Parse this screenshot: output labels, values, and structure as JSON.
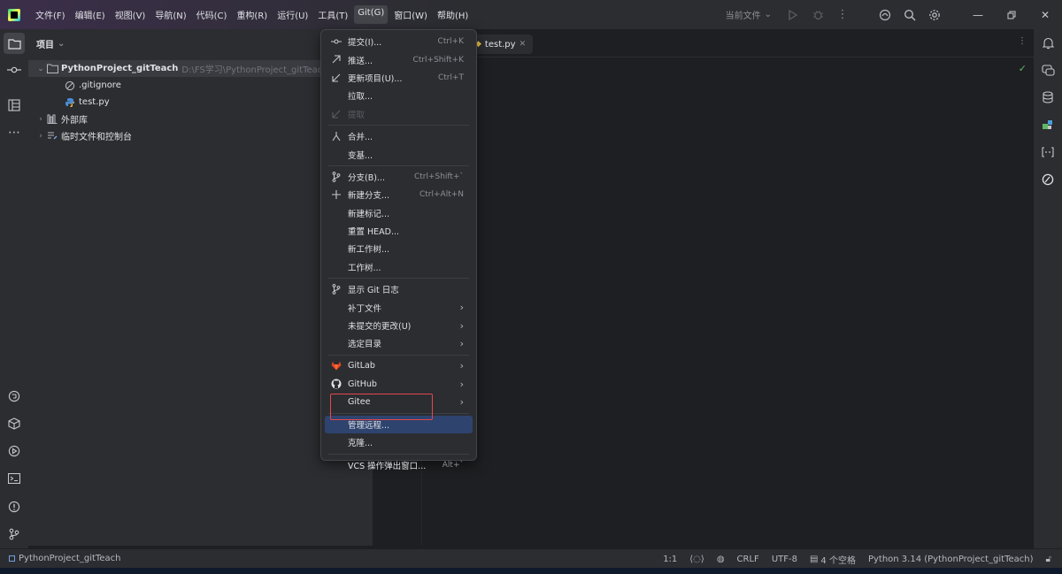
{
  "menubar": {
    "items": [
      "文件(F)",
      "编辑(E)",
      "视图(V)",
      "导航(N)",
      "代码(C)",
      "重构(R)",
      "运行(U)",
      "工具(T)",
      "Git(G)",
      "窗口(W)",
      "帮助(H)"
    ],
    "active_index": 8,
    "run_config": "当前文件"
  },
  "project_panel": {
    "title": "项目",
    "tree": [
      {
        "label": "PythonProject_gitTeach",
        "hint": "D:\\FS学习\\PythonProject_gitTeach",
        "icon": "folder-icon",
        "expanded": true,
        "level": 0,
        "bold": true
      },
      {
        "label": ".gitignore",
        "icon": "ignore-file-icon",
        "level": 1
      },
      {
        "label": "test.py",
        "icon": "python-file-icon",
        "level": 1
      },
      {
        "label": "外部库",
        "icon": "library-icon",
        "level": 0,
        "collapsed": true
      },
      {
        "label": "临时文件和控制台",
        "icon": "scratch-icon",
        "level": 0,
        "collapsed": true
      }
    ]
  },
  "editor": {
    "tab_label": "test.py"
  },
  "git_menu": {
    "items": [
      {
        "label": "提交(I)...",
        "shortcut": "Ctrl+K",
        "icon": "commit-icon"
      },
      {
        "label": "推送...",
        "shortcut": "Ctrl+Shift+K",
        "icon": "push-arrow-icon"
      },
      {
        "label": "更新项目(U)...",
        "shortcut": "Ctrl+T",
        "icon": "update-arrow-icon"
      },
      {
        "label": "拉取...",
        "shortcut": ""
      },
      {
        "label": "提取",
        "shortcut": "",
        "icon": "fetch-arrow-icon",
        "disabled": true
      },
      {
        "label": "合并...",
        "shortcut": "",
        "icon": "merge-icon"
      },
      {
        "label": "变基...",
        "shortcut": ""
      },
      {
        "label": "分支(B)...",
        "shortcut": "Ctrl+Shift+`",
        "icon": "branch-icon"
      },
      {
        "label": "新建分支...",
        "shortcut": "Ctrl+Alt+N",
        "icon": "plus-icon"
      },
      {
        "label": "新建标记...",
        "shortcut": ""
      },
      {
        "label": "重置 HEAD...",
        "shortcut": ""
      },
      {
        "label": "新工作树...",
        "shortcut": ""
      },
      {
        "label": "工作树...",
        "shortcut": ""
      },
      {
        "label": "显示 Git 日志",
        "shortcut": "",
        "icon": "git-log-icon"
      },
      {
        "label": "补丁文件",
        "submenu": true
      },
      {
        "label": "未提交的更改(U)",
        "submenu": true
      },
      {
        "label": "选定目录",
        "submenu": true
      },
      {
        "label": "GitLab",
        "submenu": true,
        "icon": "gitlab-icon"
      },
      {
        "label": "GitHub",
        "submenu": true,
        "icon": "github-icon"
      },
      {
        "label": "Gitee",
        "submenu": true
      },
      {
        "label": "管理远程...",
        "highlight": true
      },
      {
        "label": "克隆..."
      },
      {
        "label": "VCS 操作弹出窗口...",
        "shortcut": "Alt+`"
      }
    ]
  },
  "statusbar": {
    "project": "PythonProject_gitTeach",
    "position": "1:1",
    "line_sep": "CRLF",
    "encoding": "UTF-8",
    "indent": "4 个空格",
    "interpreter": "Python 3.14 (PythonProject_gitTeach)"
  },
  "colors": {
    "accent_highlight": "#2e436e",
    "annotation_box": "#e5474f",
    "background": "#1e1f22",
    "panel": "#2b2d30"
  }
}
